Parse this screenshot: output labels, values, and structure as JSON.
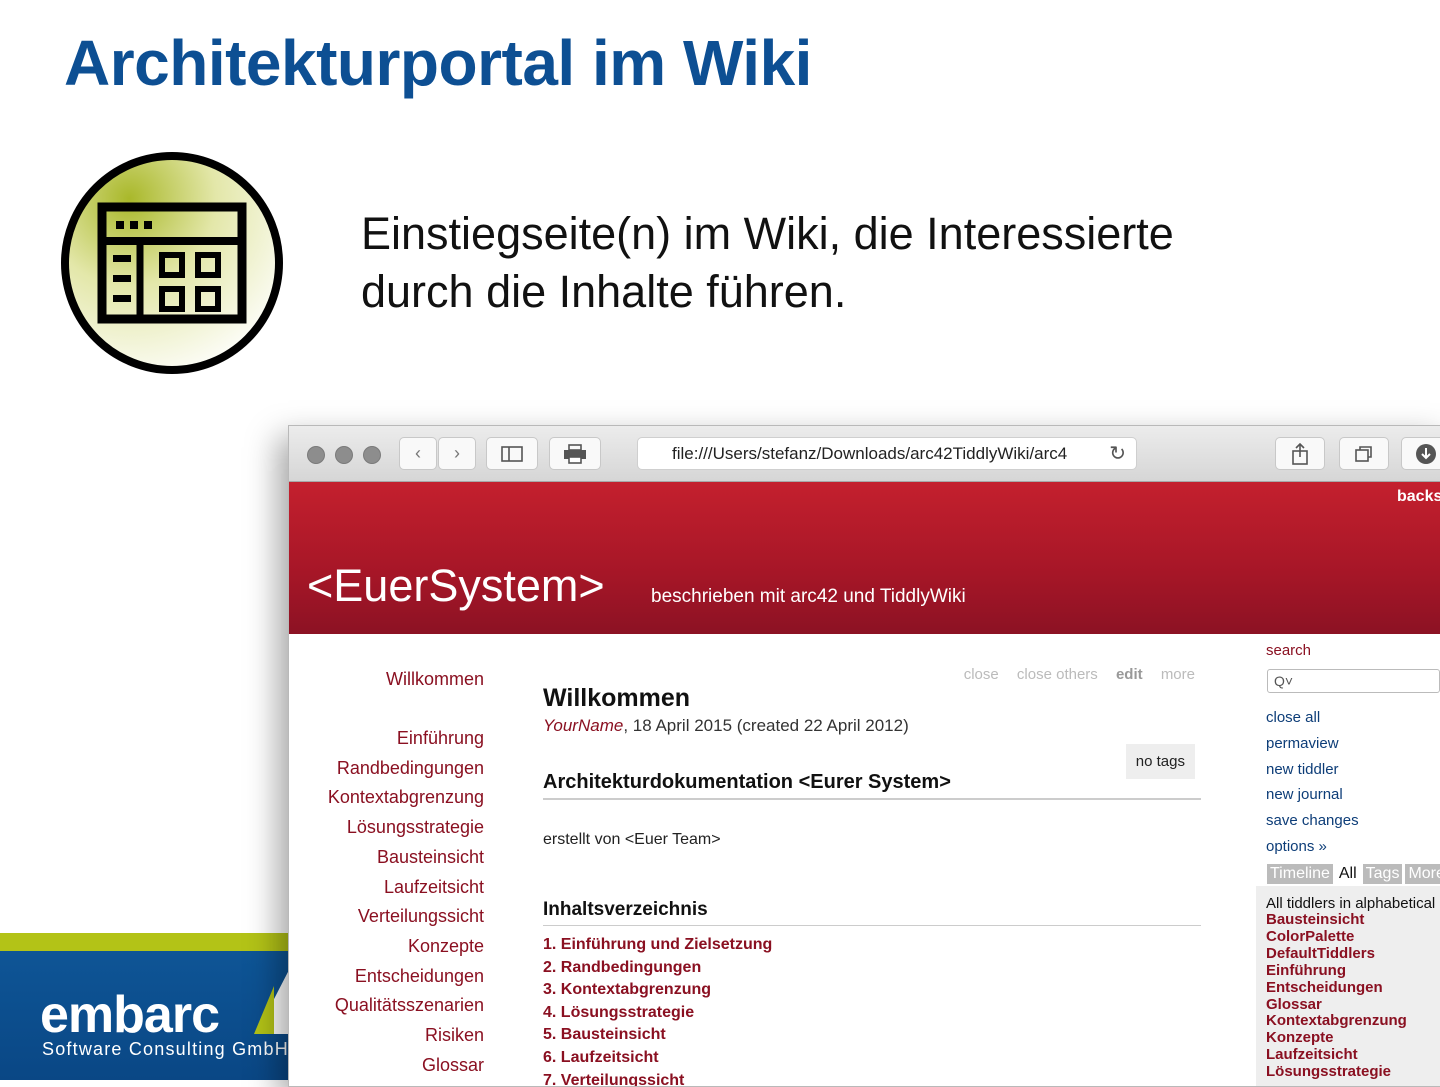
{
  "slide": {
    "title": "Architekturportal im Wiki",
    "subtitle_line1": "Einstiegseite(n) im Wiki, die Interessierte",
    "subtitle_line2": "durch die Inhalte führen.",
    "icon": "browser-window-icon",
    "logo": {
      "word": "embarc",
      "sub": "Software Consulting GmbH"
    }
  },
  "browser": {
    "url": "file:///Users/stefanz/Downloads/arc42TiddlyWiki/arc4",
    "backs_label": "backs"
  },
  "wiki": {
    "site_title": "<EuerSystem>",
    "site_subtitle": "beschrieben mit arc42 und TiddlyWiki",
    "nav_top": "Willkommen",
    "nav": [
      "Einführung",
      "Randbedingungen",
      "Kontextabgrenzung",
      "Lösungsstrategie",
      "Bausteinsicht",
      "Laufzeitsicht",
      "Verteilungssicht",
      "Konzepte",
      "Entscheidungen",
      "Qualitätsszenarien",
      "Risiken",
      "Glossar"
    ],
    "tiddler": {
      "commands": [
        "close",
        "close others",
        "edit",
        "more"
      ],
      "title": "Willkommen",
      "author": "YourName",
      "dates": ", 18 April 2015 (created 22 April 2012)",
      "tags": "no tags",
      "heading": "Architekturdokumentation <Eurer System>",
      "created_by": "erstellt von <Euer Team>",
      "toc_heading": "Inhaltsverzeichnis",
      "toc": [
        "1. Einführung und Zielsetzung",
        "2. Randbedingungen",
        "3. Kontextabgrenzung",
        "4. Lösungsstrategie",
        "5. Bausteinsicht",
        "6. Laufzeitsicht",
        "7. Verteilungssicht"
      ]
    },
    "sidebar": {
      "search_label": "search",
      "search_value": "Q˅",
      "links": [
        "close all",
        "permaview",
        "new tiddler",
        "new journal",
        "save changes",
        "options »"
      ],
      "tabs": [
        "Timeline",
        "All",
        "Tags",
        "More"
      ],
      "list_header": "All tiddlers in alphabetical",
      "list": [
        "Bausteinsicht",
        "ColorPalette",
        "DefaultTiddlers",
        "Einführung",
        "Entscheidungen",
        "Glossar",
        "Kontextabgrenzung",
        "Konzepte",
        "Laufzeitsicht",
        "Lösungsstrategie"
      ]
    }
  }
}
